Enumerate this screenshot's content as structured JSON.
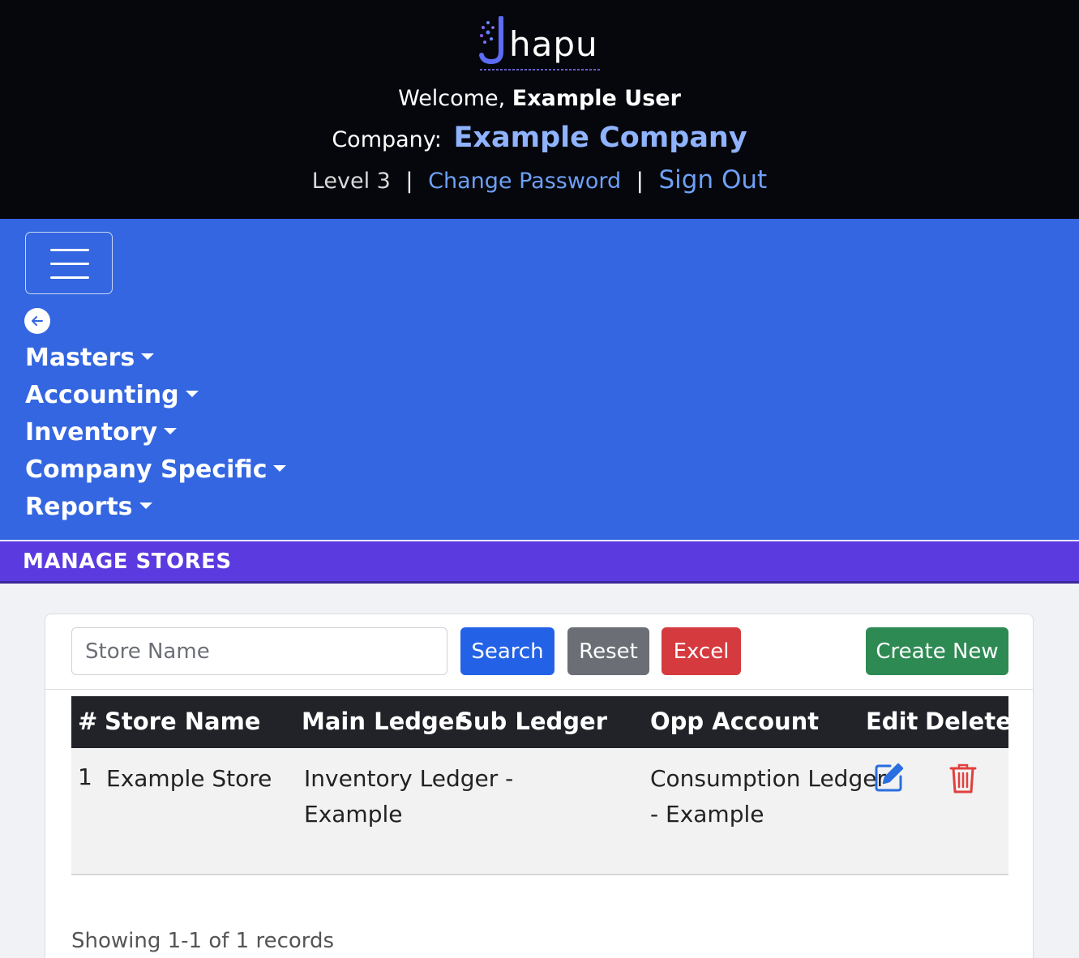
{
  "header": {
    "logo_text": "hapu",
    "welcome_prefix": "Welcome,",
    "user_name": "Example User",
    "company_label": "Company:",
    "company_name": "Example Company",
    "level": "Level 3",
    "separator": "|",
    "change_password": "Change Password",
    "sign_out": "Sign Out"
  },
  "nav": {
    "items": [
      {
        "label": "Masters"
      },
      {
        "label": "Accounting"
      },
      {
        "label": "Inventory"
      },
      {
        "label": "Company Specific"
      },
      {
        "label": "Reports"
      }
    ]
  },
  "page": {
    "title": "MANAGE STORES"
  },
  "toolbar": {
    "search_placeholder": "Store Name",
    "search_label": "Search",
    "reset_label": "Reset",
    "excel_label": "Excel",
    "create_label": "Create New"
  },
  "table": {
    "columns": [
      "#",
      "Store Name",
      "Main Ledger",
      "Sub Ledger",
      "Opp Account",
      "Edit",
      "Delete"
    ],
    "rows": [
      {
        "index": "1",
        "store_name": "Example Store",
        "main_ledger_line1": "Inventory Ledger -",
        "main_ledger_line2": "Example",
        "sub_ledger": "",
        "opp_account_line1": "Consumption Ledger",
        "opp_account_line2": "- Example"
      }
    ]
  },
  "footer": {
    "records_text": "Showing 1-1 of 1 records"
  },
  "colors": {
    "header_bg": "#05070d",
    "nav_bg": "#3366e0",
    "title_bar_bg": "#5b3be0",
    "search_btn": "#2362e6",
    "reset_btn": "#6b6f75",
    "excel_btn": "#d43a3e",
    "create_btn": "#2e8a53"
  }
}
